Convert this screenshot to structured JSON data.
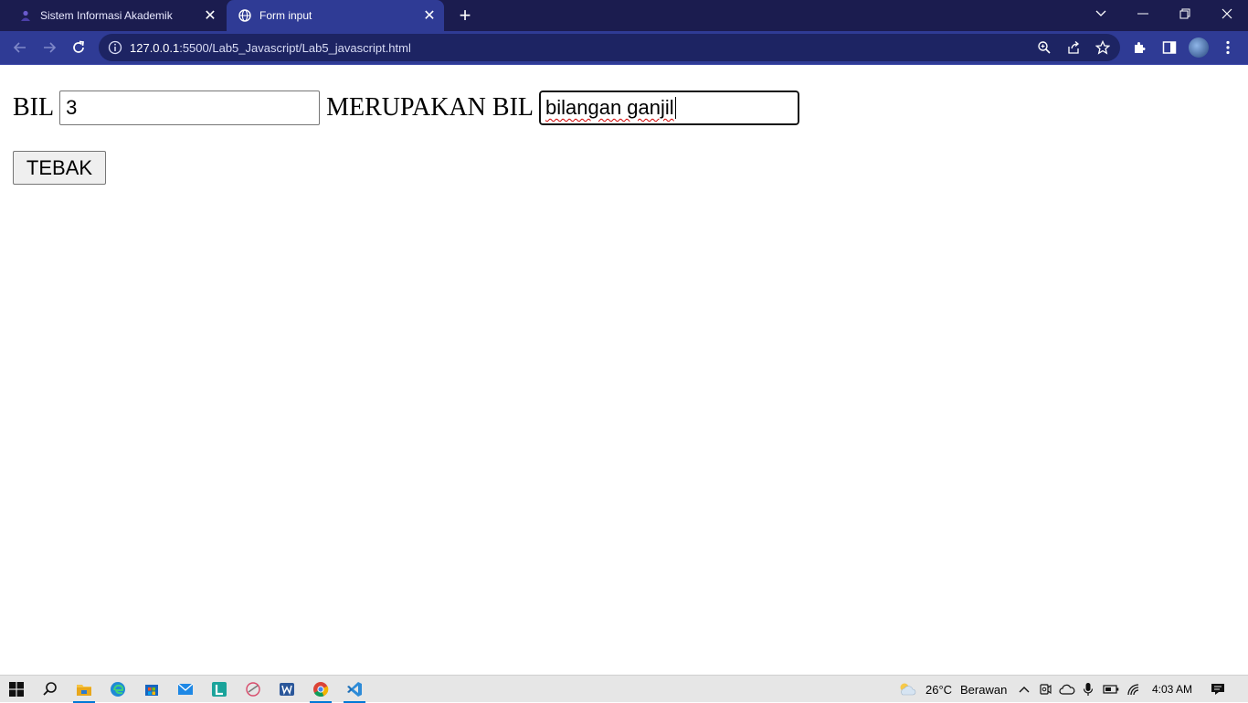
{
  "browser": {
    "tabs": [
      {
        "title": "Sistem Informasi Akademik",
        "icon": "user-favicon-icon"
      },
      {
        "title": "Form input",
        "icon": "globe-icon"
      }
    ],
    "address": {
      "host": "127.0.0.1",
      "path": ":5500/Lab5_Javascript/Lab5_javascript.html"
    },
    "colors": {
      "frame": "#1b1c4f",
      "toolbar": "#2f3b95",
      "omnibox": "#1d2463"
    }
  },
  "form": {
    "label_bil": "BIL",
    "bil_value": "3",
    "label_merupakan": "MERUPAKAN BIL",
    "result_value": "bilangan ganjil",
    "button_label": "TEBAK"
  },
  "taskbar": {
    "weather_temp": "26°C",
    "weather_desc": "Berawan",
    "time": "4:03 AM"
  }
}
